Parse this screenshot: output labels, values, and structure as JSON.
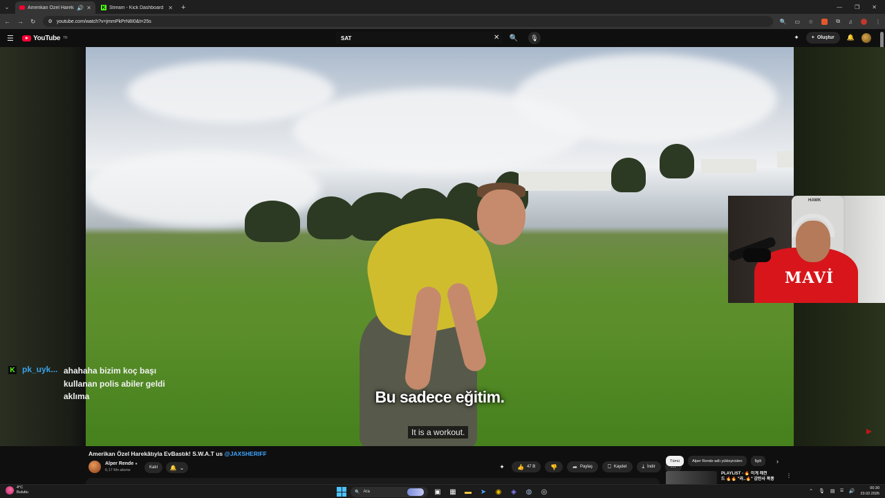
{
  "browser": {
    "tabs": [
      {
        "title": "Amerikan Özel Harekâtıyla",
        "active": true,
        "favicon": "youtube"
      },
      {
        "title": "Stream - Kick Dashboard",
        "active": false,
        "favicon": "kick"
      }
    ],
    "url": "youtube.com/watch?v=jmmPkPrN8I0&t=25s"
  },
  "youtube": {
    "logo_text": "YouTube",
    "region": "TR",
    "search_value": "SAT",
    "create_label": "Oluştur"
  },
  "video": {
    "subtitle_main": "Bu sadece eğitim.",
    "subtitle_original": "It is a workout.",
    "title_prefix": "Amerikan Özel Harekâtıyla EvBastık! S.W.A.T us ",
    "title_handle": "@JAXSHERIFF",
    "channel": "Alper Rende",
    "subscribers": "6,17 Mn abone",
    "join_label": "Katıl",
    "likes": "47 B",
    "share_label": "Paylaş",
    "save_label": "Kaydet",
    "download_label": "İndir"
  },
  "sidebar_filters": [
    "Tümü",
    "Alper Rende adlı yükleyiciden",
    "İlgili"
  ],
  "playlist_preview": {
    "line1": "PLAYLIST - 🔥 이게 레전",
    "line2": "드 🔥🔥 \"라..🔥\" 감탄사 폭풍"
  },
  "kick_chat": {
    "username": "pk_uyk...",
    "message": "ahahaha bizim koç başı kullanan polis abiler geldi aklıma"
  },
  "webcam": {
    "chair_brand": "HAWK",
    "hoodie_text": "MAVİ"
  },
  "taskbar": {
    "temperature": "4°C",
    "weather": "Bulutlu",
    "search_placeholder": "Ara",
    "time": "00:30",
    "date": "23.02.2026"
  },
  "colors": {
    "youtube_red": "#ff0033",
    "kick_green": "#53fc18",
    "handle_blue": "#3ea6ff",
    "chat_user_blue": "#3aa2e8"
  }
}
